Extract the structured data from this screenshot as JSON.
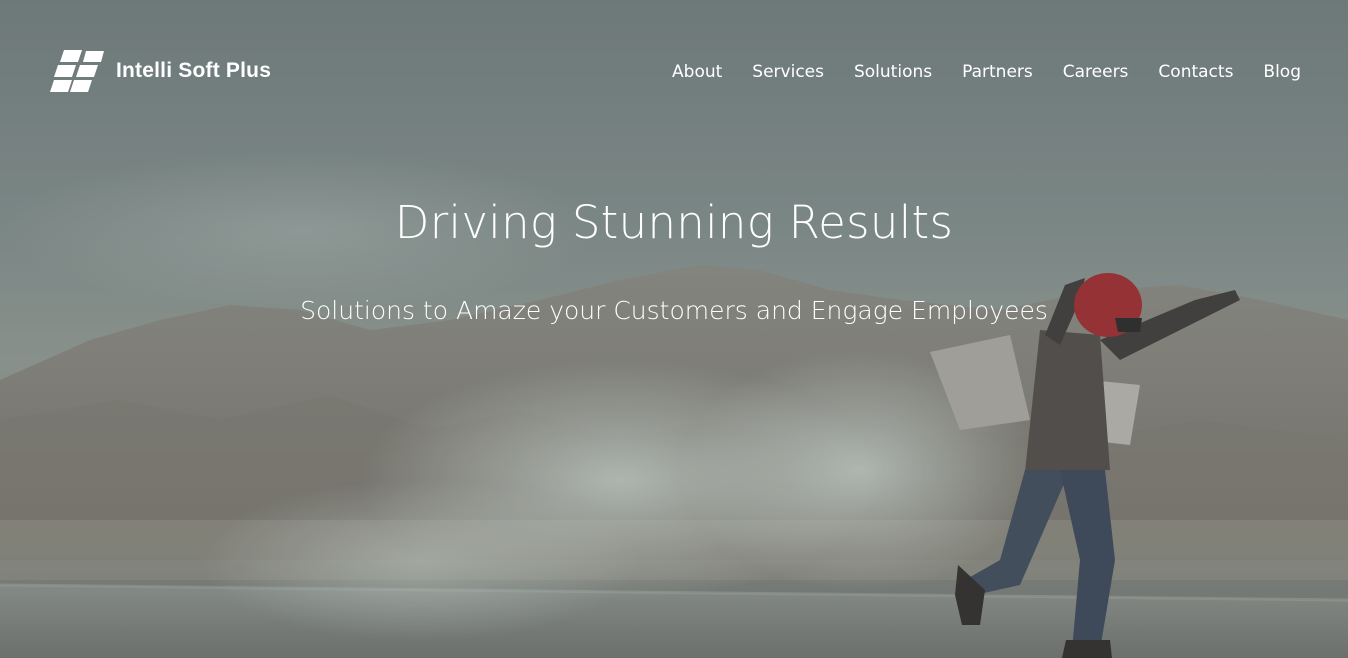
{
  "brand": {
    "name": "Intelli Soft Plus",
    "logo_icon": "checkered-flag-icon"
  },
  "nav": {
    "items": [
      {
        "label": "About"
      },
      {
        "label": "Services"
      },
      {
        "label": "Solutions"
      },
      {
        "label": "Partners"
      },
      {
        "label": "Careers"
      },
      {
        "label": "Contacts"
      },
      {
        "label": "Blog"
      }
    ]
  },
  "hero": {
    "title": "Driving Stunning Results",
    "subtitle": "Solutions to Amaze your Customers and Engage Employees"
  }
}
